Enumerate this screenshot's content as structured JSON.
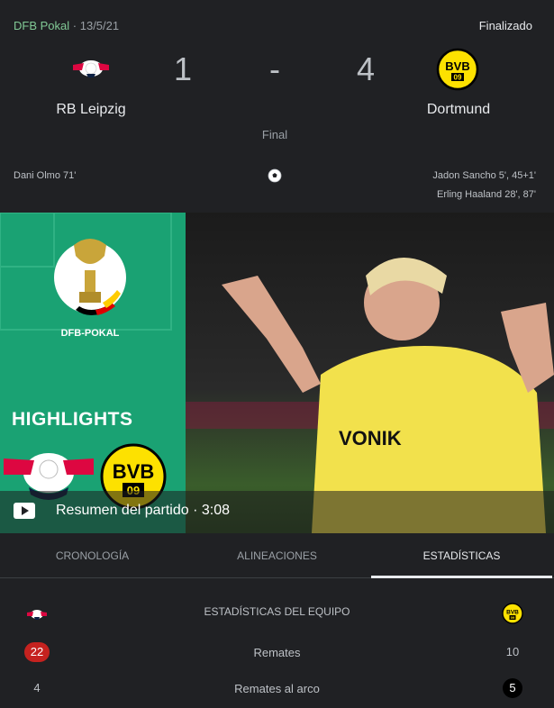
{
  "match": {
    "league": "DFB Pokal",
    "separator": "·",
    "date": "13/5/21",
    "status": "Finalizado",
    "home": {
      "name": "RB Leipzig",
      "score": "1"
    },
    "away": {
      "name": "Dortmund",
      "score": "4"
    },
    "dash": "-",
    "period_label": "Final",
    "home_scorers": [
      "Dani Olmo 71'"
    ],
    "away_scorers": [
      "Jadon Sancho 5', 45+1'",
      "Erling Haaland 28', 87'"
    ]
  },
  "video": {
    "title": "Resumen del partido · 3:08",
    "thumbnail_text": {
      "highlights": "HIGHLIGHTS",
      "cup": "DFB-POKAL"
    },
    "logo_text": {
      "away": "BVB",
      "away_year": "09"
    }
  },
  "tabs": [
    {
      "label": "CRONOLOGÍA",
      "active": false
    },
    {
      "label": "ALINEACIONES",
      "active": false
    },
    {
      "label": "ESTADÍSTICAS",
      "active": true
    }
  ],
  "stats": {
    "header": "ESTADÍSTICAS DEL EQUIPO",
    "rows": [
      {
        "label": "Remates",
        "home": "22",
        "away": "10"
      },
      {
        "label": "Remates al arco",
        "home": "4",
        "away": "5"
      }
    ]
  },
  "colors": {
    "league_accent": "#81c995",
    "highlight_red": "#c5221f",
    "promo_green": "#1aa273",
    "bvb_yellow": "#fde100",
    "leipzig_red": "#dd0741"
  }
}
